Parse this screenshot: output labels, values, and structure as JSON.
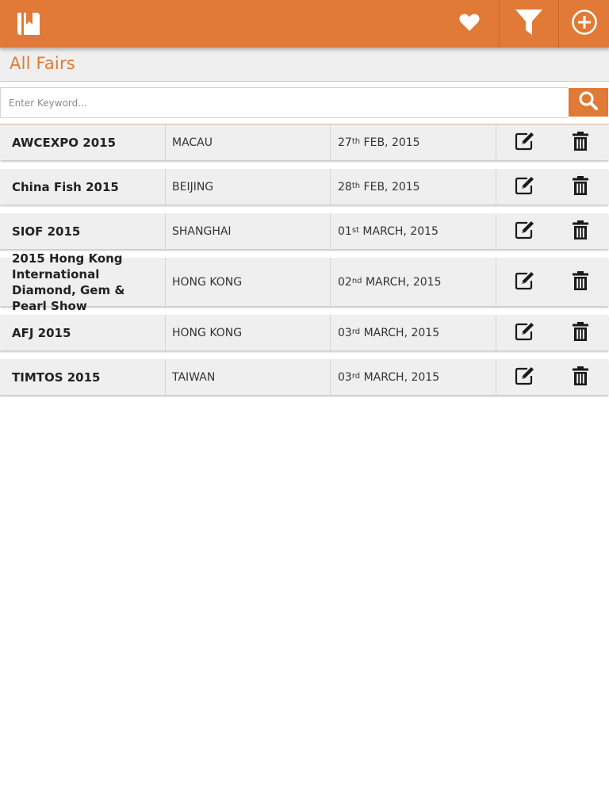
{
  "app": {
    "logo_icon": "book-bookmark-icon",
    "accent_color": "#e07a36",
    "actions": [
      {
        "name": "favorites",
        "icon": "heart-icon"
      },
      {
        "name": "filter",
        "icon": "filter-icon"
      },
      {
        "name": "add",
        "icon": "plus-circle-icon"
      }
    ]
  },
  "page": {
    "title": "All Fairs"
  },
  "search": {
    "placeholder": "Enter Keyword...",
    "value": "",
    "icon": "search-icon"
  },
  "fairs": [
    {
      "name": "AWCEXPO 2015",
      "city": "MACAU",
      "day": "27",
      "suffix": "th",
      "month_year": "FEB, 2015"
    },
    {
      "name": "China Fish 2015",
      "city": "BEIJING",
      "day": "28",
      "suffix": "th",
      "month_year": "FEB, 2015"
    },
    {
      "name": "SIOF 2015",
      "city": "SHANGHAI",
      "day": "01",
      "suffix": "st",
      "month_year": "MARCH, 2015"
    },
    {
      "name": "2015 Hong Kong International Diamond, Gem & Pearl Show",
      "city": "HONG KONG",
      "day": "02",
      "suffix": "nd",
      "month_year": "MARCH, 2015"
    },
    {
      "name": "AFJ 2015",
      "city": "HONG KONG",
      "day": "03",
      "suffix": "rd",
      "month_year": "MARCH, 2015"
    },
    {
      "name": "TIMTOS 2015",
      "city": "TAIWAN",
      "day": "03",
      "suffix": "rd",
      "month_year": "MARCH, 2015"
    }
  ],
  "row_actions": {
    "edit_icon": "edit-icon",
    "delete_icon": "trash-icon"
  }
}
